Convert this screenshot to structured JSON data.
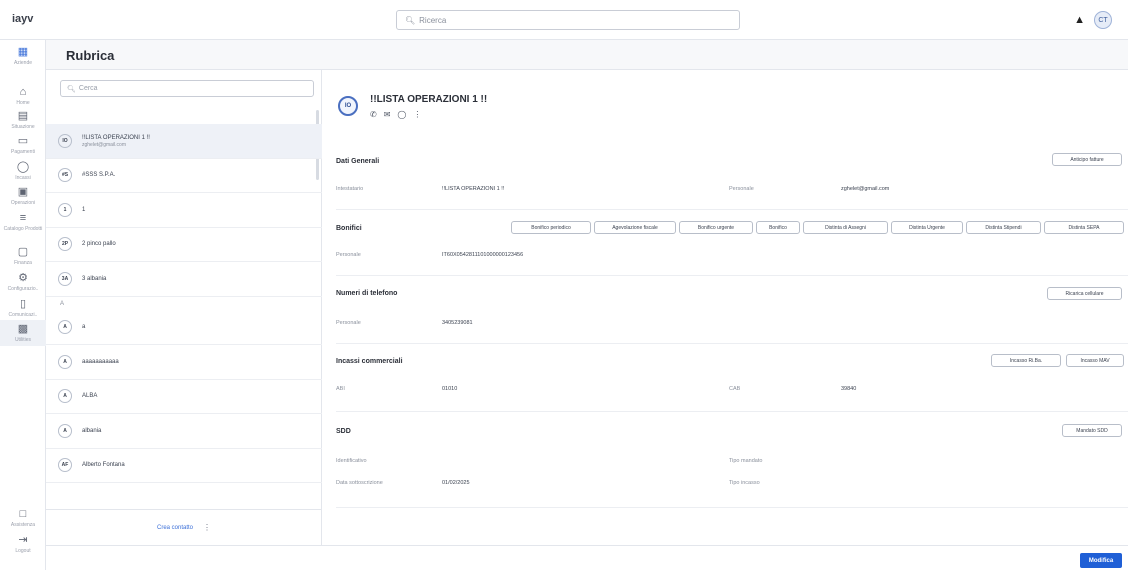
{
  "app": {
    "logo": "iayv"
  },
  "topbar": {
    "search_placeholder": "Ricerca",
    "user_initials": "CT"
  },
  "nav": {
    "items": [
      {
        "label": "Aziende",
        "icon": "company-icon"
      },
      {
        "label": "Home",
        "icon": "home-icon"
      },
      {
        "label": "Situazione",
        "icon": "situation-icon"
      },
      {
        "label": "Pagamenti",
        "icon": "payments-icon"
      },
      {
        "label": "Incassi",
        "icon": "collections-icon"
      },
      {
        "label": "Operazioni",
        "icon": "operations-icon"
      },
      {
        "label": "Catalogo Prodotti",
        "icon": "catalog-icon"
      },
      {
        "label": "Finanza",
        "icon": "finance-icon"
      },
      {
        "label": "Configurazio..",
        "icon": "settings-icon"
      },
      {
        "label": "Comunicazi..",
        "icon": "communications-icon"
      },
      {
        "label": "Utilities",
        "icon": "utilities-icon"
      }
    ],
    "bottom": [
      {
        "label": "Assistenza",
        "icon": "support-icon"
      },
      {
        "label": "Logout",
        "icon": "logout-icon"
      }
    ]
  },
  "page": {
    "title": "Rubrica"
  },
  "contacts": {
    "search_placeholder": "Cerca",
    "rows": [
      {
        "initials": "IO",
        "name": "!!LISTA OPERAZIONI 1 !!",
        "sub": "zghelet@gmail.com"
      },
      {
        "initials": "#S",
        "name": "#SSS S.P.A.",
        "sub": ""
      },
      {
        "initials": "1",
        "name": "1",
        "sub": ""
      },
      {
        "initials": "2P",
        "name": "2 pinco pallo",
        "sub": ""
      },
      {
        "initials": "3A",
        "name": "3 albania",
        "sub": ""
      }
    ],
    "letter": "A",
    "rows_a": [
      {
        "initials": "A",
        "name": "a",
        "sub": ""
      },
      {
        "initials": "A",
        "name": "aaaaaaaaaaa",
        "sub": ""
      },
      {
        "initials": "A",
        "name": "ALBA",
        "sub": ""
      },
      {
        "initials": "A",
        "name": "albania",
        "sub": ""
      },
      {
        "initials": "AF",
        "name": "Alberto Fontana",
        "sub": ""
      }
    ],
    "create_label": "Crea contatto"
  },
  "detail": {
    "initials": "IO",
    "name": "!!LISTA OPERAZIONI 1 !!",
    "dati_generali": {
      "title": "Dati Generali",
      "button": "Anticipo fatture",
      "intestatario_label": "Intestatario",
      "intestatario_value": "!!LISTA OPERAZIONI 1 !!",
      "personale_label": "Personale",
      "personale_value": "zghelet@gmail.com"
    },
    "bonifici": {
      "title": "Bonifici",
      "buttons": [
        "Bonifico periodico",
        "Agevolazione fiscale",
        "Bonifico urgente",
        "Bonifico",
        "Distinta di Assegni",
        "Distinta Urgente",
        "Distinta Stipendi",
        "Distinta SEPA"
      ],
      "label": "Personale",
      "value": "IT60X0542811101000000123456"
    },
    "telefono": {
      "title": "Numeri di telefono",
      "button": "Ricarica cellulare",
      "label": "Personale",
      "value": "3405239081"
    },
    "incassi": {
      "title": "Incassi commerciali",
      "buttons": [
        "Incasso Ri.Ba.",
        "Incasso MAV"
      ],
      "abi_label": "ABI",
      "abi_value": "01010",
      "cab_label": "CAB",
      "cab_value": "39840"
    },
    "sdd": {
      "title": "SDD",
      "button": "Mandato SDD",
      "id_label": "Identificativo",
      "tipo_mandato_label": "Tipo mandato",
      "data_label": "Data sottoscrizione",
      "data_value": "01/02/2025",
      "tipo_incasso_label": "Tipo incasso"
    }
  },
  "footer": {
    "modify_label": "Modifica"
  },
  "colors": {
    "accent": "#1f5fd6",
    "link": "#3b6fd8"
  }
}
